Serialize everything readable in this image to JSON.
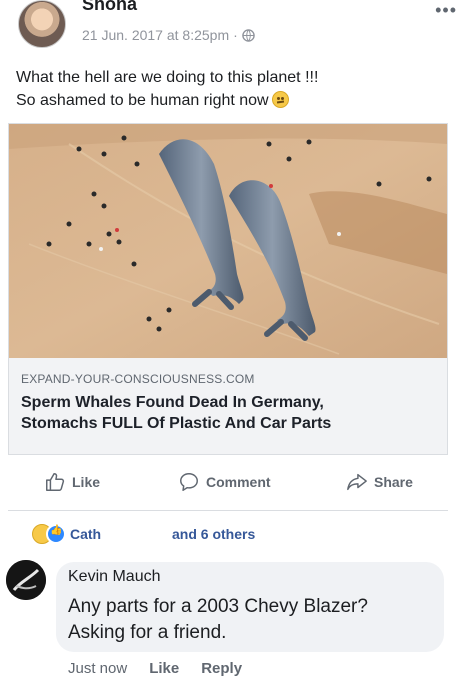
{
  "post": {
    "author": "Shona",
    "timestamp": "21 Jun. 2017 at 8:25pm",
    "privacy_sep": "·",
    "text_line1": "What the hell are we doing to this planet !!!",
    "text_line2": "So ashamed to be human right now"
  },
  "link": {
    "domain": "EXPAND-YOUR-CONSCIOUSNESS.COM",
    "title_line1": "Sperm Whales Found Dead In Germany,",
    "title_line2": "Stomachs FULL Of Plastic And Car Parts"
  },
  "actions": {
    "like": "Like",
    "comment": "Comment",
    "share": "Share"
  },
  "reactions": {
    "name": "Cath",
    "others": "and 6 others"
  },
  "comment": {
    "author": "Kevin Mauch",
    "text_line1": "Any parts for a 2003 Chevy Blazer?",
    "text_line2": "Asking for a friend.",
    "time": "Just now",
    "like": "Like",
    "reply": "Reply"
  },
  "icons": {
    "more": "more-icon",
    "globe": "globe-icon",
    "like": "thumbs-up-icon",
    "comment": "speech-bubble-icon",
    "share": "share-arrow-icon"
  },
  "colors": {
    "link_blue": "#365899",
    "meta_gray": "#90949c",
    "sand": "#d9b38c"
  }
}
